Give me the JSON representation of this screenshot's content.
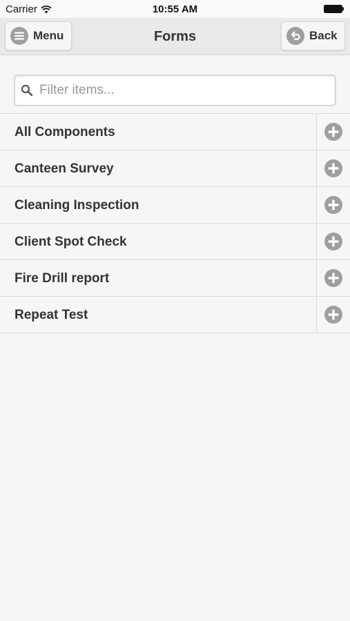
{
  "status_bar": {
    "carrier": "Carrier",
    "time": "10:55 AM"
  },
  "header": {
    "title": "Forms",
    "menu_label": "Menu",
    "back_label": "Back"
  },
  "search": {
    "placeholder": "Filter items..."
  },
  "forms": [
    {
      "label": "All Components"
    },
    {
      "label": "Canteen Survey"
    },
    {
      "label": "Cleaning Inspection"
    },
    {
      "label": "Client Spot Check"
    },
    {
      "label": "Fire Drill report"
    },
    {
      "label": "Repeat Test"
    }
  ],
  "icons": {
    "menu": "hamburger-icon",
    "back": "back-arrow-icon",
    "search": "search-icon",
    "add": "plus-icon",
    "wifi": "wifi-icon",
    "battery": "battery-icon"
  },
  "colors": {
    "icon_gray": "#9f9f9f",
    "header_bg": "#e9e9e9",
    "list_bg": "#f6f6f6"
  }
}
